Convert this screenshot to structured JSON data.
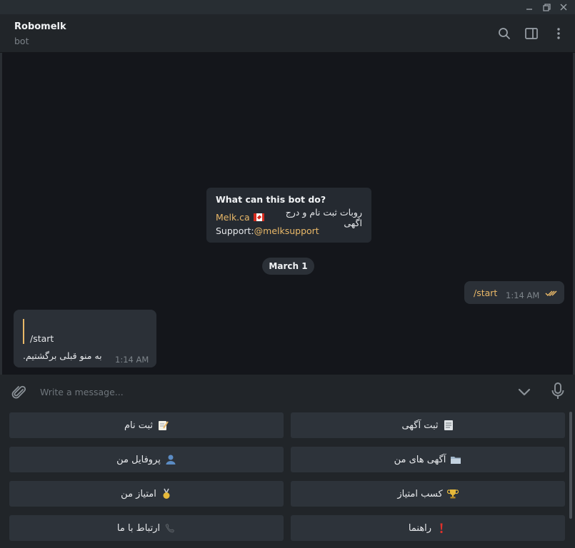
{
  "header": {
    "title": "Robomelk",
    "status": "bot"
  },
  "bot_info": {
    "title": "What can this bot do?",
    "link_text": "Melk.ca",
    "description": "روبات ثبت نام و درج اگهی",
    "support_label": "Support:",
    "support_handle": "@melksupport"
  },
  "date_divider": "March 1",
  "messages": [
    {
      "direction": "outgoing",
      "text": "/start",
      "time": "1:14 AM",
      "status": "read"
    },
    {
      "direction": "incoming",
      "quote": "/start",
      "text": "به منو قبلی برگشتیم.",
      "time": "1:14 AM"
    }
  ],
  "composer": {
    "placeholder": "Write a message..."
  },
  "keyboard": [
    {
      "label": "ثبت نام",
      "emoji": "memo"
    },
    {
      "label": "ثبت آگهی",
      "emoji": "page"
    },
    {
      "label": "پروفایل من",
      "emoji": "user"
    },
    {
      "label": "آگهی های من",
      "emoji": "folder"
    },
    {
      "label": "امتیاز من",
      "emoji": "medal"
    },
    {
      "label": "کسب امتیاز",
      "emoji": "trophy"
    },
    {
      "label": "ارتباط با ما",
      "emoji": "phone"
    },
    {
      "label": "راهنما",
      "emoji": "exclamation"
    }
  ],
  "colors": {
    "accent": "#e9b868",
    "bubble": "#2b3037",
    "background": "#14161b"
  }
}
